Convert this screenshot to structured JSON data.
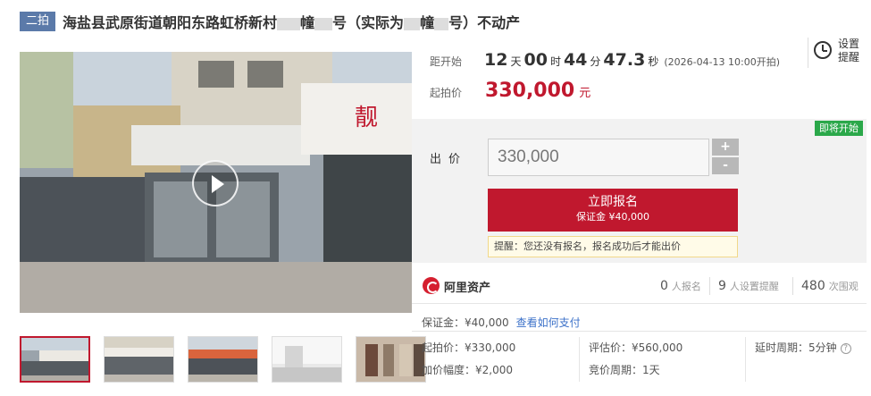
{
  "header": {
    "badge": "二拍",
    "title": "海盐县武原街道朝阳东路虹桥新村",
    "title_tail": "幢",
    "title_mid": "号（实际为",
    "title_mid2": "幢",
    "title_end": "号）不动产"
  },
  "countdown": {
    "label": "距开始",
    "days": "12",
    "days_unit": "天",
    "hours": "00",
    "hours_unit": "时",
    "minutes": "44",
    "minutes_unit": "分",
    "seconds": "47.3",
    "seconds_unit": "秒",
    "start_note": "(2026-04-13 10:00开拍)"
  },
  "reminder": {
    "label": "设置提醒",
    "icon": "alarm-clock-icon"
  },
  "starting_price": {
    "label": "起拍价",
    "value": "330,000",
    "unit": "元"
  },
  "bid": {
    "status_badge": "即将开始",
    "label": "出价",
    "value": "330,000",
    "plus": "+",
    "minus": "-",
    "signup_label": "立即报名",
    "signup_deposit": "保证金 ¥40,000",
    "tip": "提醒：您还没有报名，报名成功后才能出价"
  },
  "brand": {
    "name": "阿里资产",
    "registered_count": "0",
    "registered_label": "人报名",
    "reminder_count": "9",
    "reminder_label": "人设置提醒",
    "views_count": "480",
    "views_label": "次围观"
  },
  "deposit": {
    "text": "保证金：¥40,000",
    "link": "查看如何支付"
  },
  "details": {
    "start_price": "起拍价：¥330,000",
    "increment": "加价幅度：¥2,000",
    "appraisal": "评估价：¥560,000",
    "bid_period": "竞价周期：1天",
    "extension": "延时周期：5分钟"
  },
  "colors": {
    "accent": "#c0182e",
    "badge": "#5b7aa9",
    "soon": "#2ba84a",
    "link": "#3d72c9"
  }
}
